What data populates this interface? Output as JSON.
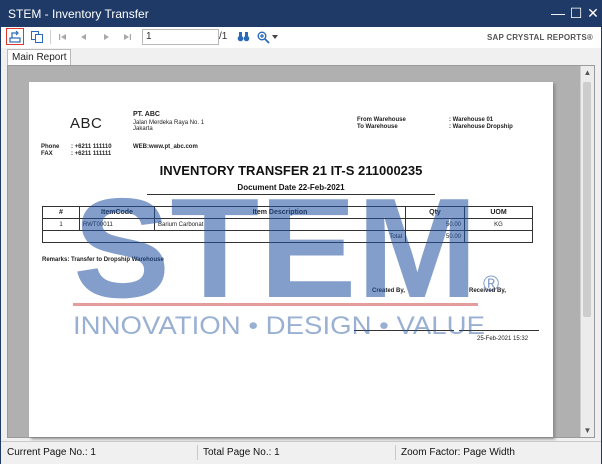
{
  "window": {
    "title": "STEM - Inventory Transfer"
  },
  "toolbar": {
    "page_value": "1",
    "page_count": "/1",
    "brand": "SAP CRYSTAL REPORTS®"
  },
  "tabs": [
    {
      "label": "Main Report"
    }
  ],
  "report": {
    "company_logo": "ABC",
    "company_name": "PT. ABC",
    "address1": "Jalan Merdeka Raya No. 1",
    "address2": "Jakarta",
    "from_label": "From Warehouse",
    "from_value": ": Warehouse 01",
    "to_label": "To Warehouse",
    "to_value": ": Warehouse Dropship",
    "phone_label": "Phone",
    "phone_value": ": +6211 111110",
    "fax_label": "FAX",
    "fax_value": ": +6211 111111",
    "web_label": "WEB:",
    "web_value": "www.pt_abc.com",
    "title": "INVENTORY TRANSFER 21 IT-S 211000235",
    "date_line": "Document  Date 22-Feb-2021",
    "table": {
      "headers": [
        "#",
        "ItemCode",
        "Item Description",
        "Qty",
        "UOM"
      ],
      "rows": [
        {
          "no": "1",
          "code": "RWT00011",
          "desc": "Barium Carbonat",
          "qty": "50.00",
          "uom": "KG"
        }
      ],
      "total_label": "Total",
      "total_value": "50.00"
    },
    "remarks": "Remarks: Transfer to Dropship Warehouse",
    "created_by": "Created By,",
    "received_by": "Received By,",
    "print_stamp": "25-Feb-2021 15:32"
  },
  "watermark": {
    "brand": "STEM",
    "tagline": "INNOVATION • DESIGN • VALUE",
    "color": "#1d4f9e"
  },
  "status": {
    "current_page": "Current Page No.: 1",
    "total_page": "Total Page No.: 1",
    "zoom": "Zoom Factor: Page Width"
  }
}
